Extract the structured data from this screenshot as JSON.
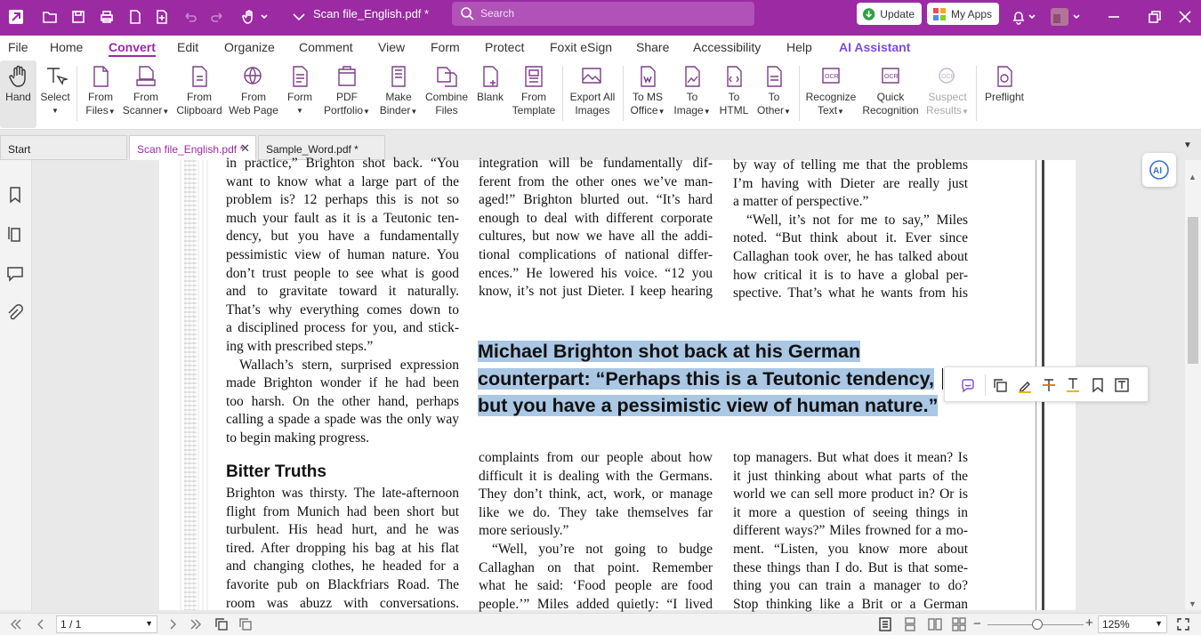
{
  "titlebar": {
    "document_title": "Scan file_English.pdf *",
    "search_placeholder": "Search",
    "update_label": "Update",
    "myapps_label": "My Apps"
  },
  "menu": [
    "File",
    "Home",
    "Convert",
    "Edit",
    "Organize",
    "Comment",
    "View",
    "Form",
    "Protect",
    "Foxit eSign",
    "Share",
    "Accessibility",
    "Help",
    "AI Assistant"
  ],
  "ribbon": {
    "hand": "Hand",
    "select": "Select",
    "from_files_1": "From",
    "from_files_2": "Files",
    "from_scanner_1": "From",
    "from_scanner_2": "Scanner",
    "from_clipboard_1": "From",
    "from_clipboard_2": "Clipboard",
    "from_webpage_1": "From",
    "from_webpage_2": "Web Page",
    "form": "Form",
    "pdf_portfolio_1": "PDF",
    "pdf_portfolio_2": "Portfolio",
    "make_binder_1": "Make",
    "make_binder_2": "Binder",
    "combine_files_1": "Combine",
    "combine_files_2": "Files",
    "blank": "Blank",
    "from_template_1": "From",
    "from_template_2": "Template",
    "export_images_1": "Export All",
    "export_images_2": "Images",
    "to_ms_office_1": "To MS",
    "to_ms_office_2": "Office",
    "to_image_1": "To",
    "to_image_2": "Image",
    "to_html_1": "To",
    "to_html_2": "HTML",
    "to_other_1": "To",
    "to_other_2": "Other",
    "recognize_text_1": "Recognize",
    "recognize_text_2": "Text",
    "quick_recognition_1": "Quick",
    "quick_recognition_2": "Recognition",
    "suspect_results_1": "Suspect",
    "suspect_results_2": "Results",
    "preflight": "Preflight"
  },
  "tabs": {
    "start": "Start",
    "scan_file": "Scan file_English.pdf *",
    "sample_word": "Sample_Word.pdf *"
  },
  "document": {
    "col1": [
      "in practice,” Brighton shot back. “You",
      "want to know what a large part of the",
      "problem is? 12 perhaps this is not so",
      "much your fault as it is a Teutonic ten-",
      "dency, but you have a fundamentally",
      "pessimistic view of human nature. You",
      "don’t trust people to see what is good",
      "and to gravitate toward it naturally.",
      "That’s why everything comes down to",
      "a disciplined process for you, and stick-",
      "ing with prescribed steps.”",
      "Wallach’s stern, surprised expression",
      "made Brighton wonder if he had been",
      "too harsh. On the other hand, perhaps",
      "calling a spade a spade was the only way",
      "to begin making progress."
    ],
    "heading": "Bitter Truths",
    "col1b": [
      "Brighton was thirsty. The late-afternoon",
      "flight from Munich had been short but",
      "turbulent. His head hurt, and he was",
      "tired. After dropping his bag at his flat",
      "and changing clothes, he headed for a",
      "favorite pub on Blackfriars Road. The",
      "room was abuzz with conversations."
    ],
    "col2": [
      "integration will be fundamentally dif-",
      "ferent from the other ones we’ve man-",
      "aged!” Brighton blurted out. “It’s hard",
      "enough to deal with different corporate",
      "cultures, but now we have all the addi-",
      "tional complications of national differ-",
      "ences.” He lowered his voice. “12 you",
      "know, it’s not just Dieter. I keep hearing"
    ],
    "pullquote": [
      "Michael Brighton shot back at his German",
      "counterpart: “Perhaps this is a Teutonic tendency,",
      "but you have a pessimistic view of human nature.”"
    ],
    "col2b": [
      "complaints from our people about how",
      "difficult it is dealing with the Germans.",
      "They don’t think, act, work, or manage",
      "like we do. They take themselves far",
      "more seriously.”",
      "“Well, you’re not going to budge",
      "Callaghan on that point. Remember",
      "what he said: ‘Food people are food",
      "people.’” Miles added quietly: “I lived"
    ],
    "col3": [
      "by way of telling me that the problems",
      "I’m having with Dieter are really just",
      "a matter of perspective.”",
      "“Well, it’s not for me to say,” Miles",
      "noted. “But think about it. Ever since",
      "Callaghan took over, he has talked about",
      "how critical it is to have a global per-",
      "spective. That’s what he wants from his"
    ],
    "col3b": [
      "top managers. But what does it mean? Is",
      "it just thinking about what parts of the",
      "world we can sell more product in? Or is",
      "it more a question of seeing things in",
      "different ways?” Miles frowned for a mo-",
      "ment. “Listen, you know more about",
      "these things than I do. But is that some-",
      "thing you can train a manager to do?",
      "Stop thinking like a Brit or a German"
    ]
  },
  "statusbar": {
    "page": "1 / 1",
    "zoom": "125%"
  },
  "colors": {
    "accent": "#9b2aa3",
    "selection": "#aac7e4"
  }
}
